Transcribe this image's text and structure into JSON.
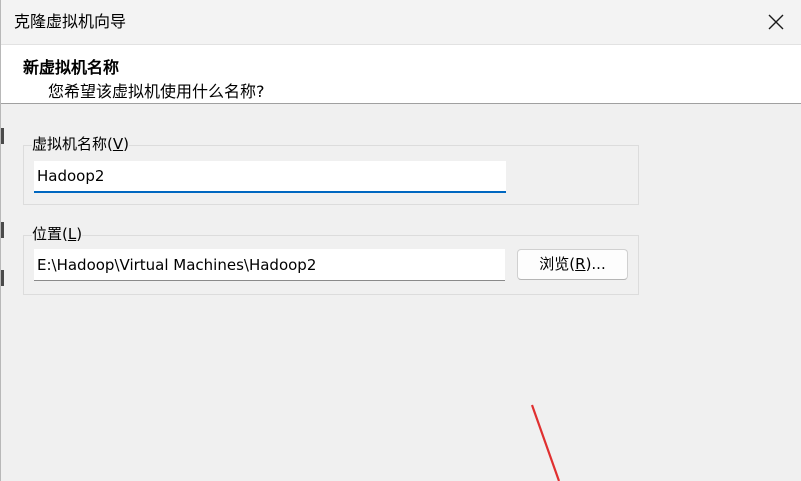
{
  "window": {
    "title": "克隆虚拟机向导"
  },
  "header": {
    "title": "新虚拟机名称",
    "subtitle": "您希望该虚拟机使用什么名称?"
  },
  "name_group": {
    "label_prefix": "虚拟机名称(",
    "label_key": "V",
    "label_suffix": ")",
    "value": "Hadoop2"
  },
  "location_group": {
    "label_prefix": "位置(",
    "label_key": "L",
    "label_suffix": ")",
    "value": "E:\\Hadoop\\Virtual Machines\\Hadoop2",
    "browse_prefix": "浏览(",
    "browse_key": "R",
    "browse_suffix": ")..."
  },
  "colors": {
    "focus_accent": "#0067c0",
    "annotation_arrow": "#e03030"
  },
  "icons": {
    "close": "close-icon"
  }
}
